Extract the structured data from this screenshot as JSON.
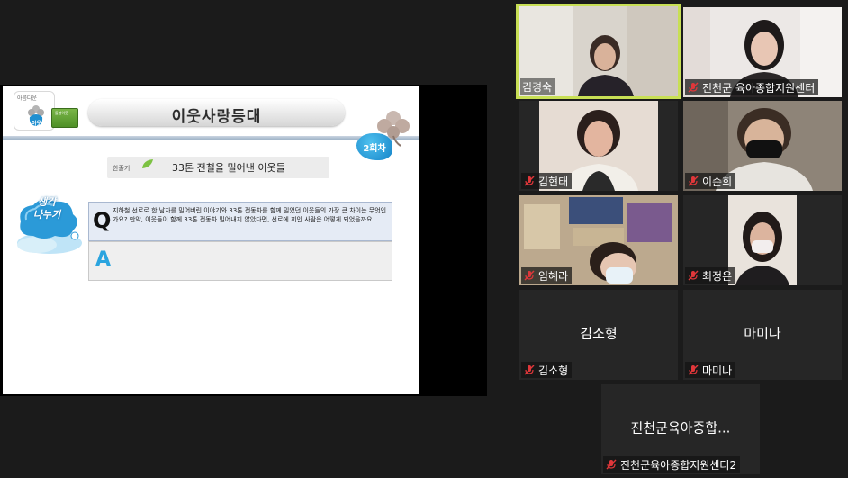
{
  "slide": {
    "logo_small": "아름다운",
    "logo_word": "이웃",
    "badge_text": "돌봄이웃",
    "title": "이웃사랑등대",
    "session": "2회차",
    "subtitle_tag": "한줄기",
    "subtitle": "33톤 전철을 밀어낸 이웃들",
    "think_line1": "생각",
    "think_line2": "나누기",
    "q_label": "Q",
    "q_text": "지하철 선로로 한 남자를 밀어버린 이야기와 33톤 전동차를 함께 밀었던 이웃들의 가장 큰 차이는 무엇인가요? 만약, 이웃들이 함께 33톤 전동차 밀어내지 않았다면, 선로에 끼인 사람은 어떻게 되었을까요",
    "a_label": "A"
  },
  "participants": [
    {
      "name": "김경숙",
      "muted": false,
      "video": true,
      "active": true
    },
    {
      "name": "진천군 육아종합지원센터",
      "muted": true,
      "video": true,
      "active": false
    },
    {
      "name": "김현태",
      "muted": true,
      "video": true,
      "active": false
    },
    {
      "name": "이순희",
      "muted": true,
      "video": true,
      "active": false
    },
    {
      "name": "임혜라",
      "muted": true,
      "video": true,
      "active": false
    },
    {
      "name": "최정은",
      "muted": true,
      "video": true,
      "active": false
    },
    {
      "name": "김소형",
      "display": "김소형",
      "muted": true,
      "video": false,
      "active": false
    },
    {
      "name": "마미나",
      "display": "마미나",
      "muted": true,
      "video": false,
      "active": false
    },
    {
      "name": "진천군육아종합지원센터2",
      "display": "진천군육아종합...",
      "muted": true,
      "video": false,
      "active": false
    }
  ],
  "colors": {
    "background": "#1b1b1b",
    "tile": "#262626",
    "active_speaker": "#c8df55",
    "muted_mic": "#e0373a",
    "answer_accent": "#2aa4df"
  },
  "icons": {
    "mic": "mic-icon",
    "muted": "mic-muted-icon"
  }
}
